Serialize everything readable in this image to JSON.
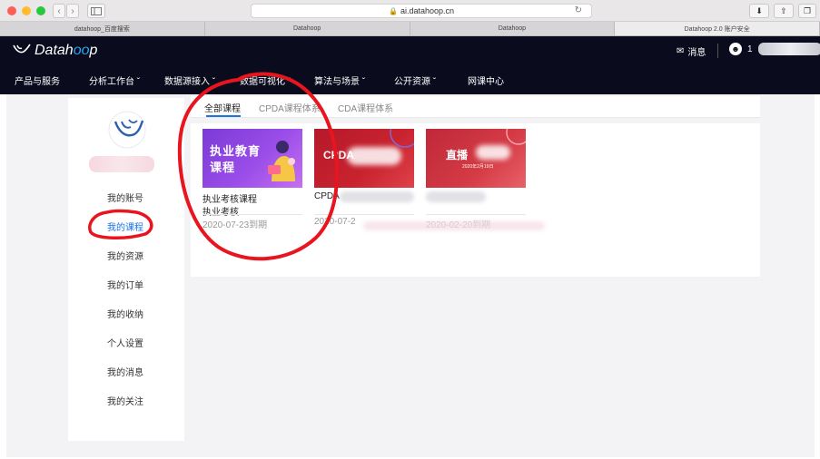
{
  "browser": {
    "url": "ai.datahoop.cn",
    "tabs": [
      "datahoop_百度搜索",
      "Datahoop",
      "Datahoop",
      "Datahoop 2.0 账户安全"
    ],
    "back_glyph": "‹",
    "forward_glyph": "›"
  },
  "header": {
    "logo_prefix": "Datah",
    "logo_highlight": "oo",
    "logo_suffix": "p",
    "messages_label": "消息",
    "user_initial": "1"
  },
  "nav": {
    "items": [
      "产品与服务",
      "分析工作台",
      "数据源接入",
      "数据可视化",
      "算法与场景",
      "公开资源",
      "网课中心"
    ]
  },
  "sidebar": {
    "items": [
      "我的账号",
      "我的课程",
      "我的资源",
      "我的订单",
      "我的收纳",
      "个人设置",
      "我的消息",
      "我的关注"
    ],
    "active": "我的课程"
  },
  "content_tabs": [
    "全部课程",
    "CPDA课程体系",
    "CDA课程体系"
  ],
  "courses": [
    {
      "thumb_line1": "执业教育",
      "thumb_line2": "课程",
      "title": "执业考核课程",
      "subtitle": "执业考核",
      "date": "2020-07-23到期"
    },
    {
      "thumb_line1": "CPDA",
      "title": "CPDA",
      "date": "2020-07-2"
    },
    {
      "thumb_line1": "直播",
      "thumb_small": "2020年2月19日",
      "date": "2020-02-20到期"
    }
  ],
  "colors": {
    "header_bg": "#0a0c1e",
    "accent": "#1a73e8",
    "annotation": "#e8141e"
  }
}
